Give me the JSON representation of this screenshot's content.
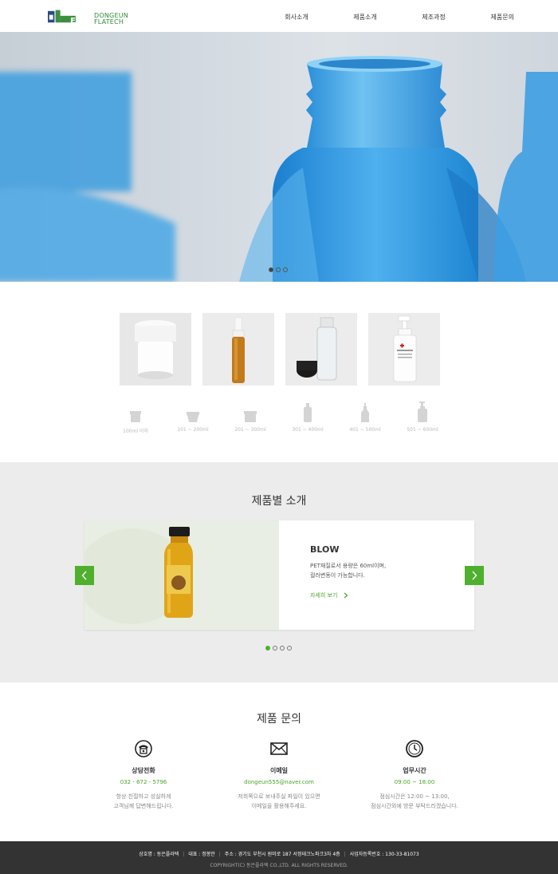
{
  "header": {
    "logo_text_1": "DONGEUN",
    "logo_text_2": "FLATECH",
    "logo_mark": "EUN",
    "nav": [
      "회사소개",
      "제품소개",
      "제조과정",
      "제품문의"
    ]
  },
  "hero": {
    "active_slide": 1,
    "slide_count": 3
  },
  "products": [
    "cream-jar",
    "amber-spray-bottle",
    "clear-bottle-with-cap",
    "pump-bottle"
  ],
  "sizes": [
    {
      "label": "100ml 이하",
      "icon": "small-jar-icon"
    },
    {
      "label": "101 ~ 200ml",
      "icon": "jar-icon"
    },
    {
      "label": "201 ~ 300ml",
      "icon": "large-jar-icon"
    },
    {
      "label": "301 ~ 400ml",
      "icon": "bottle-icon"
    },
    {
      "label": "401 ~ 500ml",
      "icon": "spray-bottle-icon"
    },
    {
      "label": "501 ~ 600ml",
      "icon": "pump-bottle-icon"
    }
  ],
  "intro": {
    "title": "제품별 소개",
    "slide": {
      "title": "BLOW",
      "desc_line1": "PET재질로서 용량은 60ml이며,",
      "desc_line2": "컬러변동이 가능합니다.",
      "link": "자세히 보기"
    },
    "active_slide": 1,
    "slide_count": 4
  },
  "contact": {
    "title": "제품 문의",
    "items": [
      {
        "icon": "telephone-icon",
        "title": "상담전화",
        "value": "032 - 672 - 5796",
        "desc": "항상 친절하고 성실하게\n고객님께 답변해드립니다."
      },
      {
        "icon": "envelope-icon",
        "title": "이메일",
        "value": "dongeun555@naver.com",
        "desc": "저희쪽으로 보내주실 파일이 있으면\n이메일을 활용해주세요."
      },
      {
        "icon": "clock-icon",
        "title": "업무시간",
        "value": "09:00 ~ 18:00",
        "desc": "점심시간은 12:00 ~ 13:00,\n점심시간외에 방문 부탁드리겠습니다."
      }
    ]
  },
  "footer": {
    "company": "상호명 : 동은플라텍",
    "ceo": "대표 : 정봉안",
    "address": "주소 : 경기도 부천시 원미로 187 서정테크노파크3차 4층",
    "biz_no": "사업자등록번호 : 130-33-81073",
    "copyright": "COPYRIGHT(C) 동은플라텍 CO.,LTD. ALL RIGHTS RESERVED."
  },
  "colors": {
    "accent": "#4fb02e",
    "logo_blue": "#2a4a8a",
    "logo_green": "#2f8a3a",
    "footer_bg": "#333333"
  }
}
